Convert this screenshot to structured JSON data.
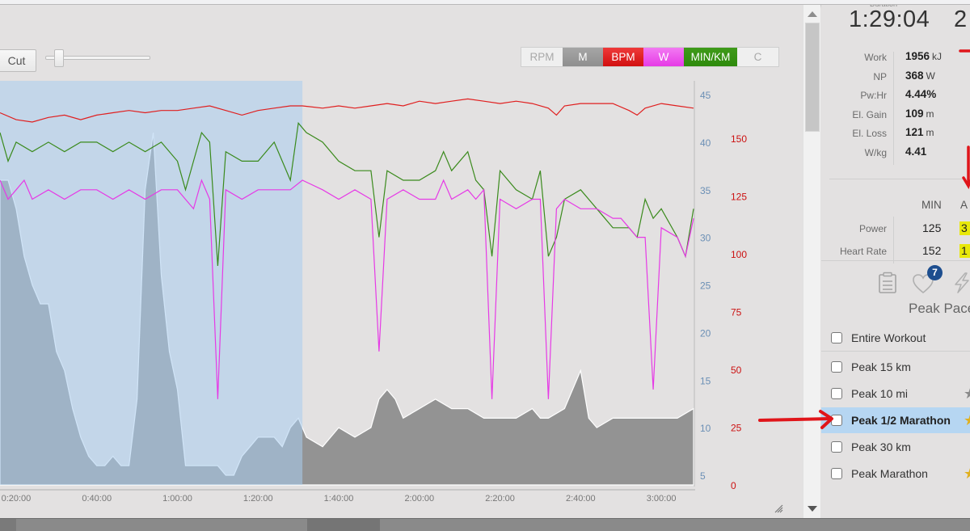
{
  "toolbar": {
    "cut_label": "Cut",
    "zoom_slider_value": 0.1,
    "metric_toggles": [
      {
        "id": "rpm",
        "label": "RPM",
        "active": false
      },
      {
        "id": "m",
        "label": "M",
        "active": true,
        "color": "#9a9a9a"
      },
      {
        "id": "bpm",
        "label": "BPM",
        "active": true,
        "color": "#e01f1f"
      },
      {
        "id": "w",
        "label": "W",
        "active": true,
        "color": "#ee4fee"
      },
      {
        "id": "minkm",
        "label": "MIN/KM",
        "active": true,
        "color": "#359010"
      },
      {
        "id": "c",
        "label": "C",
        "active": false
      }
    ]
  },
  "chart_data": {
    "type": "line",
    "x_label": "time",
    "x_ticks": [
      "0:20:00",
      "0:40:00",
      "1:00:00",
      "1:20:00",
      "1:40:00",
      "2:00:00",
      "2:20:00",
      "2:40:00",
      "3:00:00"
    ],
    "x_range_minutes": [
      16,
      188
    ],
    "selection_range_minutes": [
      16,
      91
    ],
    "pace_axis": {
      "label": "MIN/KM",
      "ticks": [
        "45",
        "40",
        "35",
        "30",
        "25",
        "20",
        "15",
        "10",
        "5"
      ],
      "range": [
        5,
        45
      ],
      "color": "#6b8fb5"
    },
    "hr_axis": {
      "label": "BPM",
      "ticks": [
        "150",
        "125",
        "100",
        "75",
        "50",
        "25",
        "0"
      ],
      "range": [
        0,
        175
      ],
      "color": "#cc1111"
    },
    "series": [
      {
        "name": "Heart Rate (BPM)",
        "color": "#e01f1f",
        "axis": "hr",
        "points": [
          [
            16,
            161
          ],
          [
            20,
            158
          ],
          [
            24,
            157
          ],
          [
            28,
            159
          ],
          [
            32,
            160
          ],
          [
            36,
            158
          ],
          [
            40,
            160
          ],
          [
            44,
            161
          ],
          [
            48,
            162
          ],
          [
            52,
            161
          ],
          [
            56,
            162
          ],
          [
            60,
            162
          ],
          [
            64,
            163
          ],
          [
            68,
            164
          ],
          [
            72,
            162
          ],
          [
            76,
            160
          ],
          [
            80,
            162
          ],
          [
            84,
            163
          ],
          [
            88,
            164
          ],
          [
            91,
            164
          ],
          [
            96,
            163
          ],
          [
            100,
            164
          ],
          [
            104,
            163
          ],
          [
            108,
            164
          ],
          [
            112,
            165
          ],
          [
            116,
            164
          ],
          [
            120,
            166
          ],
          [
            124,
            165
          ],
          [
            128,
            166
          ],
          [
            132,
            167
          ],
          [
            136,
            166
          ],
          [
            140,
            165
          ],
          [
            144,
            166
          ],
          [
            148,
            165
          ],
          [
            152,
            163
          ],
          [
            154,
            160
          ],
          [
            156,
            164
          ],
          [
            160,
            165
          ],
          [
            164,
            165
          ],
          [
            168,
            165
          ],
          [
            172,
            162
          ],
          [
            174,
            160
          ],
          [
            176,
            163
          ],
          [
            180,
            165
          ],
          [
            184,
            164
          ],
          [
            188,
            163
          ]
        ]
      },
      {
        "name": "Pace (MIN/KM)",
        "color": "#3a8a1c",
        "axis": "pace",
        "points": [
          [
            16,
            41
          ],
          [
            18,
            38
          ],
          [
            20,
            40
          ],
          [
            24,
            39
          ],
          [
            28,
            40
          ],
          [
            32,
            39
          ],
          [
            36,
            40
          ],
          [
            40,
            40
          ],
          [
            44,
            39
          ],
          [
            48,
            40
          ],
          [
            52,
            39
          ],
          [
            56,
            40
          ],
          [
            60,
            38
          ],
          [
            62,
            35
          ],
          [
            64,
            38
          ],
          [
            66,
            41
          ],
          [
            68,
            40
          ],
          [
            70,
            27
          ],
          [
            72,
            39
          ],
          [
            76,
            38
          ],
          [
            80,
            38
          ],
          [
            84,
            40
          ],
          [
            88,
            36
          ],
          [
            90,
            42
          ],
          [
            92,
            41
          ],
          [
            96,
            40
          ],
          [
            100,
            38
          ],
          [
            104,
            37
          ],
          [
            108,
            37
          ],
          [
            110,
            30
          ],
          [
            112,
            37
          ],
          [
            116,
            36
          ],
          [
            120,
            36
          ],
          [
            124,
            37
          ],
          [
            126,
            39
          ],
          [
            128,
            37
          ],
          [
            132,
            39
          ],
          [
            134,
            36
          ],
          [
            136,
            35
          ],
          [
            138,
            28
          ],
          [
            140,
            37
          ],
          [
            144,
            35
          ],
          [
            148,
            34
          ],
          [
            150,
            37
          ],
          [
            152,
            28
          ],
          [
            154,
            30
          ],
          [
            156,
            34
          ],
          [
            160,
            35
          ],
          [
            164,
            33
          ],
          [
            168,
            31
          ],
          [
            170,
            31
          ],
          [
            172,
            31
          ],
          [
            174,
            30
          ],
          [
            176,
            34
          ],
          [
            178,
            32
          ],
          [
            180,
            33
          ],
          [
            184,
            30
          ],
          [
            186,
            28
          ],
          [
            188,
            33
          ]
        ]
      },
      {
        "name": "Power (W)",
        "color": "#e63ae6",
        "axis": "pace",
        "points": [
          [
            16,
            36
          ],
          [
            18,
            34
          ],
          [
            20,
            35
          ],
          [
            22,
            36
          ],
          [
            24,
            34
          ],
          [
            28,
            35
          ],
          [
            32,
            34
          ],
          [
            36,
            35
          ],
          [
            40,
            35
          ],
          [
            44,
            34
          ],
          [
            48,
            35
          ],
          [
            52,
            34
          ],
          [
            56,
            35
          ],
          [
            60,
            35
          ],
          [
            64,
            33
          ],
          [
            66,
            36
          ],
          [
            68,
            34
          ],
          [
            70,
            13
          ],
          [
            72,
            35
          ],
          [
            76,
            34
          ],
          [
            80,
            35
          ],
          [
            84,
            35
          ],
          [
            88,
            35
          ],
          [
            91,
            36
          ],
          [
            96,
            35
          ],
          [
            100,
            34
          ],
          [
            104,
            35
          ],
          [
            108,
            34
          ],
          [
            110,
            18
          ],
          [
            112,
            34
          ],
          [
            116,
            35
          ],
          [
            120,
            34
          ],
          [
            124,
            34
          ],
          [
            126,
            36
          ],
          [
            128,
            34
          ],
          [
            132,
            35
          ],
          [
            134,
            34
          ],
          [
            136,
            35
          ],
          [
            138,
            13
          ],
          [
            140,
            34
          ],
          [
            144,
            33
          ],
          [
            148,
            34
          ],
          [
            150,
            34
          ],
          [
            152,
            13
          ],
          [
            154,
            33
          ],
          [
            156,
            34
          ],
          [
            160,
            33
          ],
          [
            164,
            33
          ],
          [
            168,
            32
          ],
          [
            170,
            32
          ],
          [
            172,
            31
          ],
          [
            174,
            30
          ],
          [
            176,
            30
          ],
          [
            178,
            14
          ],
          [
            180,
            31
          ],
          [
            184,
            30
          ],
          [
            186,
            28
          ],
          [
            188,
            32
          ]
        ]
      },
      {
        "name": "Elevation (M)",
        "color": "#9a9a9a",
        "axis": "pace",
        "filled": true,
        "points": [
          [
            16,
            36
          ],
          [
            18,
            36
          ],
          [
            20,
            33
          ],
          [
            22,
            28
          ],
          [
            24,
            25
          ],
          [
            26,
            23
          ],
          [
            28,
            23
          ],
          [
            30,
            18
          ],
          [
            32,
            16
          ],
          [
            34,
            12
          ],
          [
            36,
            9
          ],
          [
            38,
            7
          ],
          [
            40,
            6
          ],
          [
            42,
            6
          ],
          [
            44,
            7
          ],
          [
            46,
            6
          ],
          [
            48,
            6
          ],
          [
            50,
            13
          ],
          [
            52,
            35
          ],
          [
            54,
            41
          ],
          [
            56,
            26
          ],
          [
            58,
            18
          ],
          [
            60,
            14
          ],
          [
            62,
            6
          ],
          [
            64,
            6
          ],
          [
            66,
            6
          ],
          [
            68,
            6
          ],
          [
            70,
            6
          ],
          [
            72,
            5
          ],
          [
            74,
            5
          ],
          [
            76,
            7
          ],
          [
            78,
            8
          ],
          [
            80,
            9
          ],
          [
            82,
            9
          ],
          [
            84,
            9
          ],
          [
            86,
            8
          ],
          [
            88,
            10
          ],
          [
            90,
            11
          ],
          [
            92,
            9
          ],
          [
            96,
            8
          ],
          [
            100,
            10
          ],
          [
            104,
            9
          ],
          [
            108,
            10
          ],
          [
            110,
            13
          ],
          [
            112,
            14
          ],
          [
            114,
            13
          ],
          [
            116,
            11
          ],
          [
            120,
            12
          ],
          [
            124,
            13
          ],
          [
            128,
            12
          ],
          [
            132,
            12
          ],
          [
            136,
            11
          ],
          [
            140,
            11
          ],
          [
            144,
            11
          ],
          [
            148,
            12
          ],
          [
            150,
            11
          ],
          [
            152,
            11
          ],
          [
            156,
            12
          ],
          [
            160,
            16
          ],
          [
            162,
            11
          ],
          [
            164,
            10
          ],
          [
            168,
            11
          ],
          [
            172,
            11
          ],
          [
            176,
            11
          ],
          [
            180,
            11
          ],
          [
            184,
            11
          ],
          [
            188,
            12
          ]
        ]
      }
    ]
  },
  "side": {
    "duration_label": "Duration",
    "duration_value": "1:29:04",
    "next_value_partial": "2",
    "stats": [
      {
        "label": "Work",
        "value": "1956",
        "unit": "kJ"
      },
      {
        "label": "NP",
        "value": "368",
        "unit": "W"
      },
      {
        "label": "Pw:Hr",
        "value": "4.44%",
        "unit": ""
      },
      {
        "label": "El. Gain",
        "value": "109",
        "unit": "m"
      },
      {
        "label": "El. Loss",
        "value": "121",
        "unit": "m"
      },
      {
        "label": "W/kg",
        "value": "4.41",
        "unit": ""
      }
    ],
    "minavg": {
      "min_header": "MIN",
      "avg_header_partial": "A",
      "rows": [
        {
          "label": "Power",
          "min": "125",
          "avg_partial": "3"
        },
        {
          "label": "Heart Rate",
          "min": "152",
          "avg_partial": "1"
        }
      ]
    },
    "icons": {
      "notes": "clipboard-icon",
      "favorites": "heart-icon",
      "favorites_badge": "7",
      "power": "lightning-icon"
    },
    "peak_title": "Peak Pace",
    "peak_items": [
      {
        "label": "Entire Workout",
        "checked": false,
        "selected": false,
        "medal": ""
      },
      {
        "label": "Peak 15 km",
        "checked": false,
        "selected": false,
        "medal": ""
      },
      {
        "label": "Peak 10 mi",
        "checked": false,
        "selected": false,
        "medal": "silver"
      },
      {
        "label": "Peak 1/2 Marathon",
        "checked": false,
        "selected": true,
        "medal": "gold"
      },
      {
        "label": "Peak 30 km",
        "checked": false,
        "selected": false,
        "medal": ""
      },
      {
        "label": "Peak Marathon",
        "checked": false,
        "selected": false,
        "medal": "gold"
      }
    ]
  },
  "annotations": {
    "arrow_color": "#e0151a"
  }
}
